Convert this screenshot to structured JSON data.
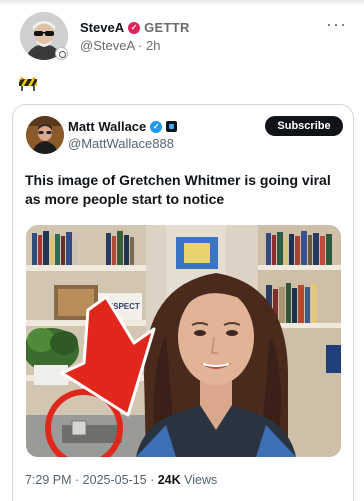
{
  "outer_post": {
    "author_name": "SteveA",
    "source_label": "GETTR",
    "handle": "@SteveA",
    "time": "· 2h",
    "more": "···",
    "emoji": "construction-barrier"
  },
  "quoted_post": {
    "author_name": "Matt Wallace",
    "handle": "@MattWallace888",
    "subscribe_label": "Subscribe",
    "text": "This image of Gretchen Whitmer is going viral as more people start to notice",
    "timestamp": "7:29 PM · 2025-05-15 · ",
    "views_count": "24K",
    "views_label": "Views"
  },
  "colors": {
    "gettr_red": "#e0245e",
    "verified_blue": "#1d9bf0",
    "arrow_red": "#e1261c"
  }
}
